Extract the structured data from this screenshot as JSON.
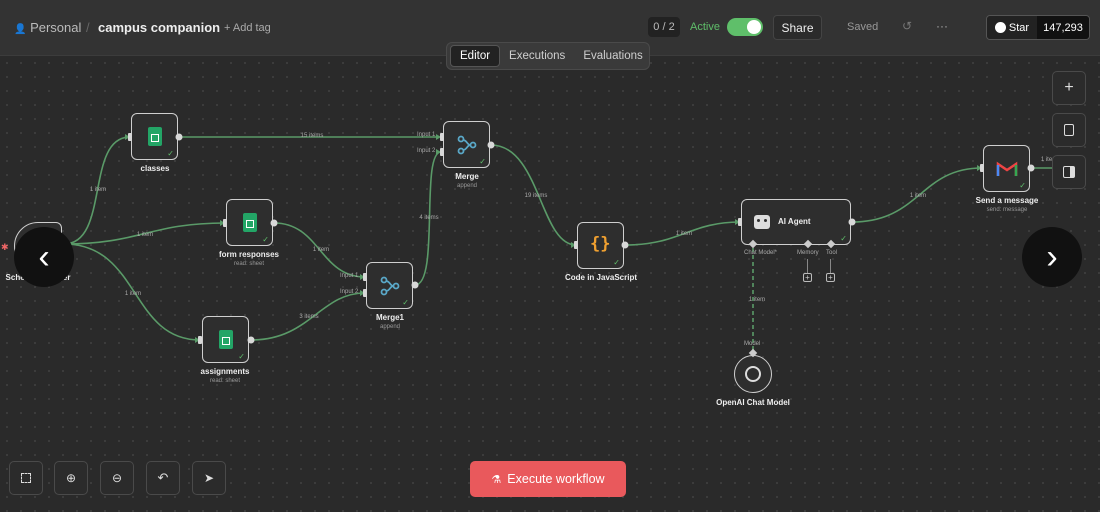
{
  "header": {
    "workspace": "Personal",
    "separator": "/",
    "workflow_name": "campus companion",
    "add_tag": "+ Add tag",
    "counter": "0 / 2",
    "active_label": "Active",
    "share_label": "Share",
    "saved_label": "Saved",
    "more_label": "···",
    "star_label": "Star",
    "star_count": "147,293"
  },
  "tabs": [
    "Editor",
    "Executions",
    "Evaluations"
  ],
  "nodes": {
    "schedule": {
      "label": "Schedule Trigger"
    },
    "classes": {
      "label": "classes"
    },
    "form_responses": {
      "label": "form responses",
      "sub": "read: sheet"
    },
    "assignments": {
      "label": "assignments",
      "sub": "read: sheet"
    },
    "merge": {
      "label": "Merge",
      "sub": "append",
      "in1": "Input 1",
      "in2": "Input 2"
    },
    "merge1": {
      "label": "Merge1",
      "sub": "append",
      "in1": "Input 1",
      "in2": "Input 2"
    },
    "code": {
      "label": "Code in JavaScript"
    },
    "agent": {
      "label": "AI Agent",
      "port_chat": "Chat Model*",
      "port_memory": "Memory",
      "port_tool": "Tool"
    },
    "openai": {
      "label": "OpenAI Chat Model",
      "port": "Model"
    },
    "gmail": {
      "label": "Send a message",
      "sub": "send: message"
    }
  },
  "edges": {
    "trigger_classes": "1 item",
    "trigger_form": "1 item",
    "trigger_assign": "1 item",
    "classes_merge": "15 items",
    "form_merge1": "1 item",
    "assign_merge1": "3 items",
    "merge1_merge": "4 items",
    "merge_code": "19 items",
    "code_agent": "1 item",
    "model_agent": "1 item",
    "agent_gmail": "1 item",
    "gmail_out": "1 item"
  },
  "execute_label": "Execute workflow",
  "colors": {
    "accent_green": "#5fbf6a",
    "execute_red": "#e9595c",
    "edge": "#5a9a68"
  }
}
